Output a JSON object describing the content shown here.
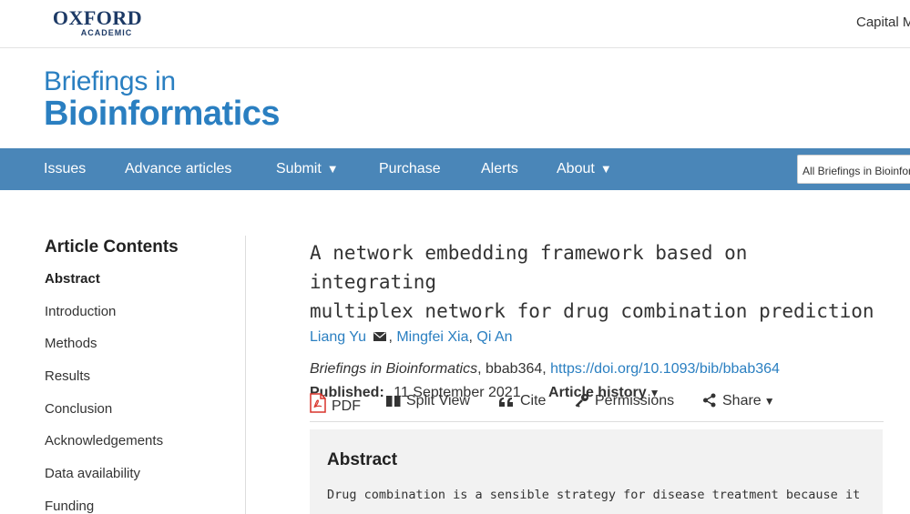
{
  "publisher": {
    "name": "OXFORD",
    "subname": "ACADEMIC"
  },
  "top_right_link": "Capital M",
  "journal": {
    "line1": "Briefings in",
    "line2": "Bioinformatics"
  },
  "nav": {
    "items": [
      {
        "label": "Issues",
        "has_caret": false
      },
      {
        "label": "Advance articles",
        "has_caret": false
      },
      {
        "label": "Submit",
        "has_caret": true
      },
      {
        "label": "Purchase",
        "has_caret": false
      },
      {
        "label": "Alerts",
        "has_caret": false
      },
      {
        "label": "About",
        "has_caret": true
      }
    ],
    "caret": "▼",
    "search_scope": "All Briefings in Bioinfor"
  },
  "sidebar": {
    "title": "Article Contents",
    "items": [
      {
        "label": "Abstract",
        "active": true
      },
      {
        "label": "Introduction",
        "active": false
      },
      {
        "label": "Methods",
        "active": false
      },
      {
        "label": "Results",
        "active": false
      },
      {
        "label": "Conclusion",
        "active": false
      },
      {
        "label": "Acknowledgements",
        "active": false
      },
      {
        "label": "Data availability",
        "active": false
      },
      {
        "label": "Funding",
        "active": false
      }
    ]
  },
  "article": {
    "title_line1": "A network embedding framework based on integrating",
    "title_line2": "multiplex network for drug combination prediction",
    "authors": [
      "Liang Yu",
      "Mingfei Xia",
      "Qi An"
    ],
    "author_separator": ", ",
    "journal_name": "Briefings in Bioinformatics",
    "article_id": ", bbab364, ",
    "doi": "https://doi.org/10.1093/bib/bbab364",
    "published_label": "Published:",
    "published_date": "11 September 2021",
    "history_label": "Article history",
    "history_caret": "▼"
  },
  "toolbar": {
    "pdf": "PDF",
    "split_view": "Split View",
    "cite": "Cite",
    "permissions": "Permissions",
    "share": "Share",
    "share_caret": "▼"
  },
  "abstract": {
    "heading": "Abstract",
    "text": "Drug combination is a sensible strategy for disease treatment because it"
  },
  "colors": {
    "brand_blue": "#2a7fc1",
    "nav_bg": "#4a86b8",
    "publisher_navy": "#1d3a66",
    "abstract_bg": "#f2f2f2",
    "pdf_red": "#d9342b"
  },
  "icons": {
    "mail": "envelope-icon",
    "pdf": "pdf-file-icon",
    "split_view": "split-view-icon",
    "cite": "quote-icon",
    "permissions": "key-icon",
    "share": "share-icon"
  }
}
